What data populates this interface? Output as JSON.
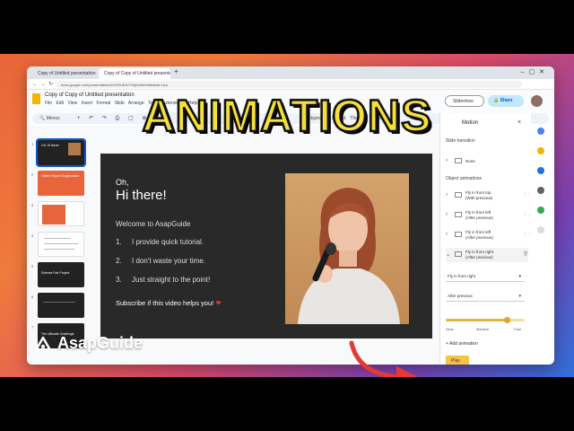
{
  "browser": {
    "tab1": "Copy of Untitled presentation",
    "tab2": "Copy of Copy of Untitled presentation",
    "url": "docs.google.com/presentation/d/1XRL8Hv7X5q0dW/edit#slide=id.p"
  },
  "docs": {
    "title": "Copy of Copy of Untitled presentation",
    "menu": "File Edit View Insert Format Slide Arrange Tools Extensions Help",
    "slideshow_label": "Slideshow",
    "share_label": "Share",
    "toolbar_menus": "Menus",
    "toolbar_right": "Background Layout Theme Transition"
  },
  "thumbnails": [
    {
      "num": "1",
      "text": "Oh, Hi there!"
    },
    {
      "num": "2",
      "text": "Online Report Organization"
    },
    {
      "num": "3",
      "text": ""
    },
    {
      "num": "4",
      "text": ""
    },
    {
      "num": "5",
      "text": "Science Fair Project"
    },
    {
      "num": "6",
      "text": ""
    },
    {
      "num": "7",
      "text": "The Ultimate Challenge"
    }
  ],
  "slide": {
    "greeting": "Oh,",
    "headline": "Hi there!",
    "welcome": "Welcome to AsapGuide",
    "items": [
      {
        "num": "1.",
        "text": "I provide quick tutorial."
      },
      {
        "num": "2.",
        "text": "I don't waste your time."
      },
      {
        "num": "3.",
        "text": "Just straight to the point!"
      }
    ],
    "subscribe": "Subscribe if this video helps you!",
    "heart": "❤"
  },
  "panel": {
    "title": "Motion",
    "close": "×",
    "slide_transition_label": "Slide transition",
    "transition_value": "None",
    "object_animations_label": "Object animations",
    "animations": [
      {
        "name": "Fly in from top",
        "trigger": "(With previous)"
      },
      {
        "name": "Fly in from left",
        "trigger": "(After previous)"
      },
      {
        "name": "Fly in from left",
        "trigger": "(After previous)"
      },
      {
        "name": "Fly in from right",
        "trigger": "(After previous)"
      }
    ],
    "effect_value": "Fly in from right",
    "trigger_value": "After previous",
    "speed": {
      "slow": "Slow",
      "medium": "Medium",
      "fast": "Fast",
      "value": 0.78
    },
    "add_animation": "+ Add animation",
    "play": "Play"
  },
  "overlay": {
    "title": "ANIMATIONS",
    "brand": "AsapGuide"
  },
  "colors": {
    "title_yellow": "#f5e03a",
    "accent_blue": "#0b57d0",
    "arrow_red": "#e53935",
    "play_yellow": "#f6c343"
  }
}
